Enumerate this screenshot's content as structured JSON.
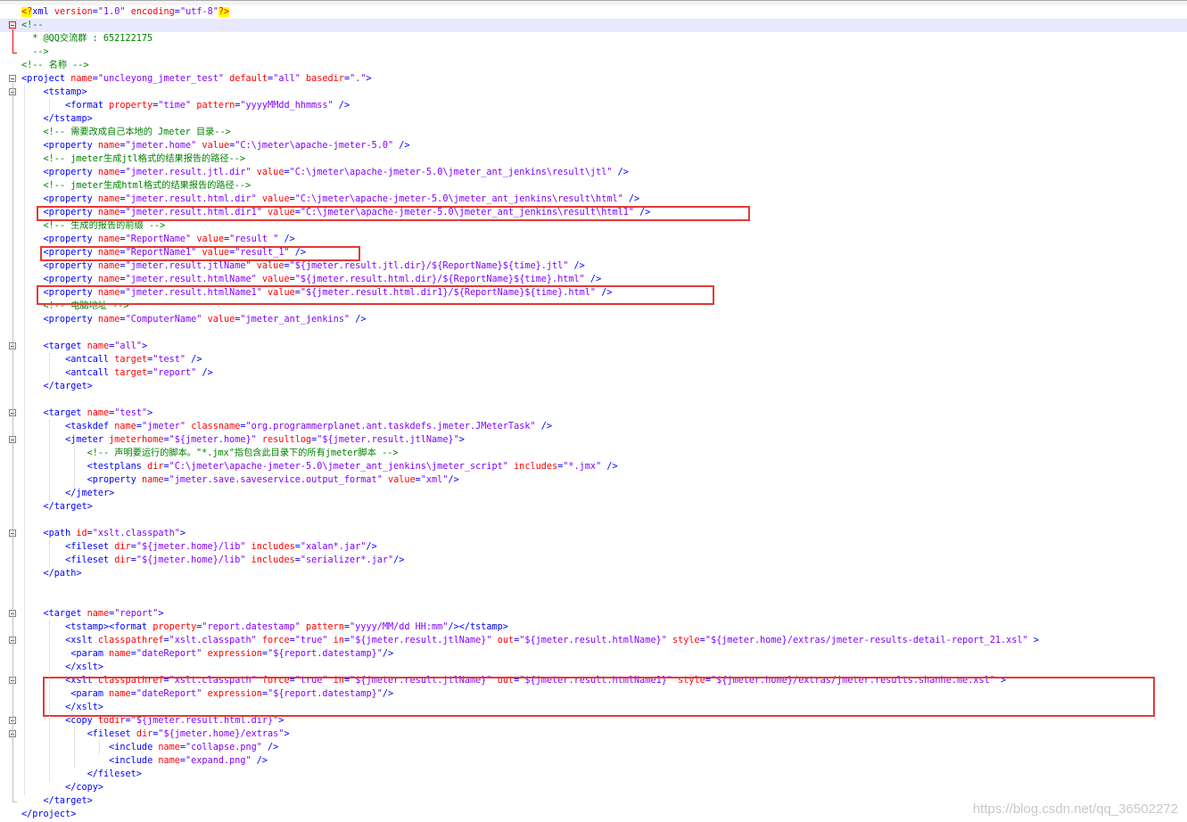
{
  "watermark": "https://blog.csdn.net/qq_36502272",
  "lines": [
    [
      [
        "pi",
        "<?"
      ],
      [
        "tag",
        "xml "
      ],
      [
        "attr",
        "version"
      ],
      [
        "tag",
        "="
      ],
      [
        "val",
        "\"1.0\""
      ],
      [
        "tag",
        " "
      ],
      [
        "attr",
        "encoding"
      ],
      [
        "tag",
        "="
      ],
      [
        "val",
        "\"utf-8\""
      ],
      [
        "pi",
        "?>"
      ]
    ],
    [
      [
        "com",
        "<!--"
      ]
    ],
    [
      [
        "com",
        "  * @QQ交流群 : 652122175"
      ]
    ],
    [
      [
        "com",
        "  -->"
      ]
    ],
    [
      [
        "com",
        "<!-- 名称 -->"
      ]
    ],
    [
      [
        "tag",
        "<project "
      ],
      [
        "attr",
        "name"
      ],
      [
        "tag",
        "="
      ],
      [
        "val",
        "\"uncleyong_jmeter_test\""
      ],
      [
        "tag",
        " "
      ],
      [
        "attr",
        "default"
      ],
      [
        "tag",
        "="
      ],
      [
        "val",
        "\"all\""
      ],
      [
        "tag",
        " "
      ],
      [
        "attr",
        "basedir"
      ],
      [
        "tag",
        "="
      ],
      [
        "val",
        "\".\""
      ],
      [
        "tag",
        ">"
      ]
    ],
    [
      [
        "tag",
        "    <tstamp>"
      ]
    ],
    [
      [
        "tag",
        "        <format "
      ],
      [
        "attr",
        "property"
      ],
      [
        "tag",
        "="
      ],
      [
        "val",
        "\"time\""
      ],
      [
        "tag",
        " "
      ],
      [
        "attr",
        "pattern"
      ],
      [
        "tag",
        "="
      ],
      [
        "val",
        "\"yyyyMMdd_hhmmss\""
      ],
      [
        "tag",
        " />"
      ]
    ],
    [
      [
        "tag",
        "    </tstamp>"
      ]
    ],
    [
      [
        "com",
        "    <!-- 需要改成自己本地的 Jmeter 目录-->"
      ]
    ],
    [
      [
        "tag",
        "    <property "
      ],
      [
        "attr",
        "name"
      ],
      [
        "tag",
        "="
      ],
      [
        "val",
        "\"jmeter.home\""
      ],
      [
        "tag",
        " "
      ],
      [
        "attr",
        "value"
      ],
      [
        "tag",
        "="
      ],
      [
        "val",
        "\"C:\\jmeter\\apache-jmeter-5.0\""
      ],
      [
        "tag",
        " />"
      ]
    ],
    [
      [
        "com",
        "    <!-- jmeter生成jtl格式的结果报告的路径-->"
      ]
    ],
    [
      [
        "tag",
        "    <property "
      ],
      [
        "attr",
        "name"
      ],
      [
        "tag",
        "="
      ],
      [
        "val",
        "\"jmeter.result.jtl.dir\""
      ],
      [
        "tag",
        " "
      ],
      [
        "attr",
        "value"
      ],
      [
        "tag",
        "="
      ],
      [
        "val",
        "\"C:\\jmeter\\apache-jmeter-5.0\\jmeter_ant_jenkins\\result\\jtl\""
      ],
      [
        "tag",
        " />"
      ]
    ],
    [
      [
        "com",
        "    <!-- jmeter生成html格式的结果报告的路径-->"
      ]
    ],
    [
      [
        "tag",
        "    <property "
      ],
      [
        "attr",
        "name"
      ],
      [
        "tag",
        "="
      ],
      [
        "val",
        "\"jmeter.result.html.dir\""
      ],
      [
        "tag",
        " "
      ],
      [
        "attr",
        "value"
      ],
      [
        "tag",
        "="
      ],
      [
        "val",
        "\"C:\\jmeter\\apache-jmeter-5.0\\jmeter_ant_jenkins\\result\\html\""
      ],
      [
        "tag",
        " />"
      ]
    ],
    [
      [
        "tag",
        "    <property "
      ],
      [
        "attr",
        "name"
      ],
      [
        "tag",
        "="
      ],
      [
        "val",
        "\"jmeter.result.html.dir1\""
      ],
      [
        "tag",
        " "
      ],
      [
        "attr",
        "value"
      ],
      [
        "tag",
        "="
      ],
      [
        "val",
        "\"C:\\jmeter\\apache-jmeter-5.0\\jmeter_ant_jenkins\\result\\html1\""
      ],
      [
        "tag",
        " />"
      ]
    ],
    [
      [
        "com",
        "    <!-- 生成的报告的前缀 -->"
      ]
    ],
    [
      [
        "tag",
        "    <property "
      ],
      [
        "attr",
        "name"
      ],
      [
        "tag",
        "="
      ],
      [
        "val",
        "\"ReportName\""
      ],
      [
        "tag",
        " "
      ],
      [
        "attr",
        "value"
      ],
      [
        "tag",
        "="
      ],
      [
        "val",
        "\"result \""
      ],
      [
        "tag",
        " />"
      ]
    ],
    [
      [
        "tag",
        "    <property "
      ],
      [
        "attr",
        "name"
      ],
      [
        "tag",
        "="
      ],
      [
        "val",
        "\"ReportName1\""
      ],
      [
        "tag",
        " "
      ],
      [
        "attr",
        "value"
      ],
      [
        "tag",
        "="
      ],
      [
        "val",
        "\"result_1\""
      ],
      [
        "tag",
        " />"
      ]
    ],
    [
      [
        "tag",
        "    <property "
      ],
      [
        "attr",
        "name"
      ],
      [
        "tag",
        "="
      ],
      [
        "val",
        "\"jmeter.result.jtlName\""
      ],
      [
        "tag",
        " "
      ],
      [
        "attr",
        "value"
      ],
      [
        "tag",
        "="
      ],
      [
        "val",
        "\"${jmeter.result.jtl.dir}/${ReportName}${time}.jtl\""
      ],
      [
        "tag",
        " />"
      ]
    ],
    [
      [
        "tag",
        "    <property "
      ],
      [
        "attr",
        "name"
      ],
      [
        "tag",
        "="
      ],
      [
        "val",
        "\"jmeter.result.htmlName\""
      ],
      [
        "tag",
        " "
      ],
      [
        "attr",
        "value"
      ],
      [
        "tag",
        "="
      ],
      [
        "val",
        "\"${jmeter.result.html.dir}/${ReportName}${time}.html\""
      ],
      [
        "tag",
        " />"
      ]
    ],
    [
      [
        "tag",
        "    <property "
      ],
      [
        "attr",
        "name"
      ],
      [
        "tag",
        "="
      ],
      [
        "val",
        "\"jmeter.result.htmlName1\""
      ],
      [
        "tag",
        " "
      ],
      [
        "attr",
        "value"
      ],
      [
        "tag",
        "="
      ],
      [
        "val",
        "\"${jmeter.result.html.dir1}/${ReportName}${time}.html\""
      ],
      [
        "tag",
        " />"
      ]
    ],
    [
      [
        "com",
        "    <!-- 电脑地址 -->"
      ]
    ],
    [
      [
        "tag",
        "    <property "
      ],
      [
        "attr",
        "name"
      ],
      [
        "tag",
        "="
      ],
      [
        "val",
        "\"ComputerName\""
      ],
      [
        "tag",
        " "
      ],
      [
        "attr",
        "value"
      ],
      [
        "tag",
        "="
      ],
      [
        "val",
        "\"jmeter_ant_jenkins\""
      ],
      [
        "tag",
        " />"
      ]
    ],
    [],
    [
      [
        "tag",
        "    <target "
      ],
      [
        "attr",
        "name"
      ],
      [
        "tag",
        "="
      ],
      [
        "val",
        "\"all\""
      ],
      [
        "tag",
        ">"
      ]
    ],
    [
      [
        "tag",
        "        <antcall "
      ],
      [
        "attr",
        "target"
      ],
      [
        "tag",
        "="
      ],
      [
        "val",
        "\"test\""
      ],
      [
        "tag",
        " />"
      ]
    ],
    [
      [
        "tag",
        "        <antcall "
      ],
      [
        "attr",
        "target"
      ],
      [
        "tag",
        "="
      ],
      [
        "val",
        "\"report\""
      ],
      [
        "tag",
        " />"
      ]
    ],
    [
      [
        "tag",
        "    </target>"
      ]
    ],
    [],
    [
      [
        "tag",
        "    <target "
      ],
      [
        "attr",
        "name"
      ],
      [
        "tag",
        "="
      ],
      [
        "val",
        "\"test\""
      ],
      [
        "tag",
        ">"
      ]
    ],
    [
      [
        "tag",
        "        <taskdef "
      ],
      [
        "attr",
        "name"
      ],
      [
        "tag",
        "="
      ],
      [
        "val",
        "\"jmeter\""
      ],
      [
        "tag",
        " "
      ],
      [
        "attr",
        "classname"
      ],
      [
        "tag",
        "="
      ],
      [
        "val",
        "\"org.programmerplanet.ant.taskdefs.jmeter.JMeterTask\""
      ],
      [
        "tag",
        " />"
      ]
    ],
    [
      [
        "tag",
        "        <jmeter "
      ],
      [
        "attr",
        "jmeterhome"
      ],
      [
        "tag",
        "="
      ],
      [
        "val",
        "\"${jmeter.home}\""
      ],
      [
        "tag",
        " "
      ],
      [
        "attr",
        "resultlog"
      ],
      [
        "tag",
        "="
      ],
      [
        "val",
        "\"${jmeter.result.jtlName}\""
      ],
      [
        "tag",
        ">"
      ]
    ],
    [
      [
        "com",
        "            <!-- 声明要运行的脚本。\"*.jmx\"指包含此目录下的所有jmeter脚本 -->"
      ]
    ],
    [
      [
        "tag",
        "            <testplans "
      ],
      [
        "attr",
        "dir"
      ],
      [
        "tag",
        "="
      ],
      [
        "val",
        "\"C:\\jmeter\\apache-jmeter-5.0\\jmeter_ant_jenkins\\jmeter_script\""
      ],
      [
        "tag",
        " "
      ],
      [
        "attr",
        "includes"
      ],
      [
        "tag",
        "="
      ],
      [
        "val",
        "\"*.jmx\""
      ],
      [
        "tag",
        " />"
      ]
    ],
    [
      [
        "tag",
        "            <property "
      ],
      [
        "attr",
        "name"
      ],
      [
        "tag",
        "="
      ],
      [
        "val",
        "\"jmeter.save.saveservice.output_format\""
      ],
      [
        "tag",
        " "
      ],
      [
        "attr",
        "value"
      ],
      [
        "tag",
        "="
      ],
      [
        "val",
        "\"xml\""
      ],
      [
        "tag",
        "/>"
      ]
    ],
    [
      [
        "tag",
        "        </jmeter>"
      ]
    ],
    [
      [
        "tag",
        "    </target>"
      ]
    ],
    [],
    [
      [
        "tag",
        "    <path "
      ],
      [
        "attr",
        "id"
      ],
      [
        "tag",
        "="
      ],
      [
        "val",
        "\"xslt.classpath\""
      ],
      [
        "tag",
        ">"
      ]
    ],
    [
      [
        "tag",
        "        <fileset "
      ],
      [
        "attr",
        "dir"
      ],
      [
        "tag",
        "="
      ],
      [
        "val",
        "\"${jmeter.home}/lib\""
      ],
      [
        "tag",
        " "
      ],
      [
        "attr",
        "includes"
      ],
      [
        "tag",
        "="
      ],
      [
        "val",
        "\"xalan*.jar\""
      ],
      [
        "tag",
        "/>"
      ]
    ],
    [
      [
        "tag",
        "        <fileset "
      ],
      [
        "attr",
        "dir"
      ],
      [
        "tag",
        "="
      ],
      [
        "val",
        "\"${jmeter.home}/lib\""
      ],
      [
        "tag",
        " "
      ],
      [
        "attr",
        "includes"
      ],
      [
        "tag",
        "="
      ],
      [
        "val",
        "\"serializer*.jar\""
      ],
      [
        "tag",
        "/>"
      ]
    ],
    [
      [
        "tag",
        "    </path>"
      ]
    ],
    [],
    [],
    [
      [
        "tag",
        "    <target "
      ],
      [
        "attr",
        "name"
      ],
      [
        "tag",
        "="
      ],
      [
        "val",
        "\"report\""
      ],
      [
        "tag",
        ">"
      ]
    ],
    [
      [
        "tag",
        "        <tstamp><format "
      ],
      [
        "attr",
        "property"
      ],
      [
        "tag",
        "="
      ],
      [
        "val",
        "\"report.datestamp\""
      ],
      [
        "tag",
        " "
      ],
      [
        "attr",
        "pattern"
      ],
      [
        "tag",
        "="
      ],
      [
        "val",
        "\"yyyy/MM/dd HH:mm\""
      ],
      [
        "tag",
        "/></tstamp>"
      ]
    ],
    [
      [
        "tag",
        "        <xslt "
      ],
      [
        "attr",
        "classpathref"
      ],
      [
        "tag",
        "="
      ],
      [
        "val",
        "\"xslt.classpath\""
      ],
      [
        "tag",
        " "
      ],
      [
        "attr",
        "force"
      ],
      [
        "tag",
        "="
      ],
      [
        "val",
        "\"true\""
      ],
      [
        "tag",
        " "
      ],
      [
        "attr",
        "in"
      ],
      [
        "tag",
        "="
      ],
      [
        "val",
        "\"${jmeter.result.jtlName}\""
      ],
      [
        "tag",
        " "
      ],
      [
        "attr",
        "out"
      ],
      [
        "tag",
        "="
      ],
      [
        "val",
        "\"${jmeter.result.htmlName}\""
      ],
      [
        "tag",
        " "
      ],
      [
        "attr",
        "style"
      ],
      [
        "tag",
        "="
      ],
      [
        "val",
        "\"${jmeter.home}/extras/jmeter-results-detail-report_21.xsl\""
      ],
      [
        "tag",
        " >"
      ]
    ],
    [
      [
        "tag",
        "         <param "
      ],
      [
        "attr",
        "name"
      ],
      [
        "tag",
        "="
      ],
      [
        "val",
        "\"dateReport\""
      ],
      [
        "tag",
        " "
      ],
      [
        "attr",
        "expression"
      ],
      [
        "tag",
        "="
      ],
      [
        "val",
        "\"${report.datestamp}\""
      ],
      [
        "tag",
        "/>"
      ]
    ],
    [
      [
        "tag",
        "        </xslt>"
      ]
    ],
    [
      [
        "tag",
        "        <xslt "
      ],
      [
        "attr",
        "classpathref"
      ],
      [
        "tag",
        "="
      ],
      [
        "val",
        "\"xslt.classpath\""
      ],
      [
        "tag",
        " "
      ],
      [
        "attr",
        "force"
      ],
      [
        "tag",
        "="
      ],
      [
        "val",
        "\"true\""
      ],
      [
        "tag",
        " "
      ],
      [
        "attr",
        "in"
      ],
      [
        "tag",
        "="
      ],
      [
        "val",
        "\"${jmeter.result.jtlName}\""
      ],
      [
        "tag",
        " "
      ],
      [
        "attr",
        "out"
      ],
      [
        "tag",
        "="
      ],
      [
        "val",
        "\"${jmeter.result.htmlName1}\""
      ],
      [
        "tag",
        " "
      ],
      [
        "attr",
        "style"
      ],
      [
        "tag",
        "="
      ],
      [
        "val",
        "\"${jmeter.home}/extras/jmeter.results.shanhe.me.xsl\""
      ],
      [
        "tag",
        " >"
      ]
    ],
    [
      [
        "tag",
        "         <param "
      ],
      [
        "attr",
        "name"
      ],
      [
        "tag",
        "="
      ],
      [
        "val",
        "\"dateReport\""
      ],
      [
        "tag",
        " "
      ],
      [
        "attr",
        "expression"
      ],
      [
        "tag",
        "="
      ],
      [
        "val",
        "\"${report.datestamp}\""
      ],
      [
        "tag",
        "/>"
      ]
    ],
    [
      [
        "tag",
        "        </xslt>"
      ]
    ],
    [
      [
        "tag",
        "        <copy "
      ],
      [
        "attr",
        "todir"
      ],
      [
        "tag",
        "="
      ],
      [
        "val",
        "\"${jmeter.result.html.dir}\""
      ],
      [
        "tag",
        ">"
      ]
    ],
    [
      [
        "tag",
        "            <fileset "
      ],
      [
        "attr",
        "dir"
      ],
      [
        "tag",
        "="
      ],
      [
        "val",
        "\"${jmeter.home}/extras\""
      ],
      [
        "tag",
        ">"
      ]
    ],
    [
      [
        "tag",
        "                <include "
      ],
      [
        "attr",
        "name"
      ],
      [
        "tag",
        "="
      ],
      [
        "val",
        "\"collapse.png\""
      ],
      [
        "tag",
        " />"
      ]
    ],
    [
      [
        "tag",
        "                <include "
      ],
      [
        "attr",
        "name"
      ],
      [
        "tag",
        "="
      ],
      [
        "val",
        "\"expand.png\""
      ],
      [
        "tag",
        " />"
      ]
    ],
    [
      [
        "tag",
        "            </fileset>"
      ]
    ],
    [
      [
        "tag",
        "        </copy>"
      ]
    ],
    [
      [
        "tag",
        "    </target>"
      ]
    ],
    [
      [
        "tag",
        "</project>"
      ]
    ]
  ]
}
